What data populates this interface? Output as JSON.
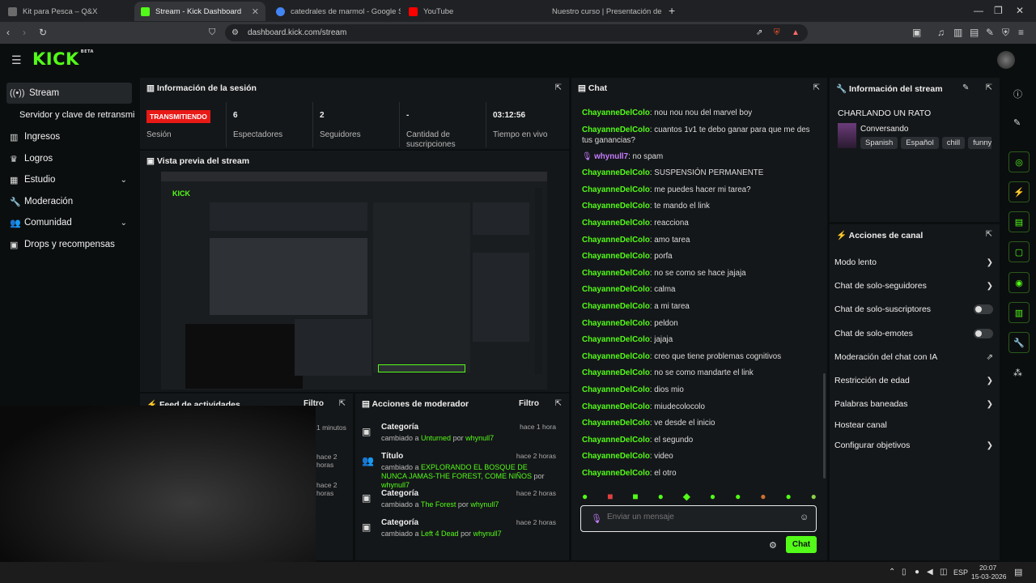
{
  "browser": {
    "tabs": [
      {
        "title": "Kit para Pesca – Q&X",
        "color": "#6b6b6b"
      },
      {
        "title": "Stream - Kick Dashboard",
        "color": "#53fc18"
      },
      {
        "title": "catedrales de marmol - Google Searc",
        "color": "#4285f4"
      },
      {
        "title": "YouTube",
        "color": "#ff0000"
      },
      {
        "title": "Nuestro curso | Presentación del curs",
        "color": "#444"
      }
    ],
    "new_tab": "+",
    "url": "dashboard.kick.com/stream"
  },
  "header": {
    "logo": "KICK",
    "logo_sup": "BETA"
  },
  "sidebar": {
    "items": [
      {
        "label": "Stream",
        "icon": "broadcast-icon"
      },
      {
        "label": "Servidor y clave de retransmi"
      },
      {
        "label": "Ingresos",
        "icon": "chart-icon"
      },
      {
        "label": "Logros",
        "icon": "trophy-icon"
      },
      {
        "label": "Estudio",
        "icon": "grid-icon"
      },
      {
        "label": "Moderación",
        "icon": "wrench-icon"
      },
      {
        "label": "Comunidad",
        "icon": "users-icon"
      },
      {
        "label": "Drops y recompensas",
        "icon": "gift-icon"
      }
    ]
  },
  "session": {
    "title": "Información de la sesión",
    "badge": "TRANSMITIENDO",
    "session_label": "Sesión",
    "stats": [
      {
        "value": "6",
        "label": "Espectadores"
      },
      {
        "value": "2",
        "label": "Seguidores"
      },
      {
        "value": "-",
        "label": "Cantidad de suscripciones"
      },
      {
        "value": "03:12:56",
        "label": "Tiempo en vivo"
      }
    ]
  },
  "preview": {
    "title": "Vista previa del stream"
  },
  "activity": {
    "title": "Feed de actividades",
    "filter": "Filtro",
    "times": [
      "1 minutos",
      "hace 2 horas",
      "hace 2 horas"
    ]
  },
  "mod_actions": {
    "title": "Acciones de moderador",
    "filter": "Filtro",
    "items": [
      {
        "type": "Categoría",
        "pre": "cambiado a ",
        "value": "Unturned",
        "by": " por ",
        "user": "whynull7",
        "time": "hace 1 hora"
      },
      {
        "type": "Título",
        "pre": "cambiado a ",
        "value": "EXPLORANDO EL BOSQUE DE NUNCA JAMAS-THE FOREST, COME NIÑOS",
        "by": " por ",
        "user": "whynull7",
        "time": "hace 2 horas"
      },
      {
        "type": "Categoría",
        "pre": "cambiado a ",
        "value": "The Forest",
        "by": " por ",
        "user": "whynull7",
        "time": "hace 2 horas"
      },
      {
        "type": "Categoría",
        "pre": "cambiado a ",
        "value": "Left 4 Dead",
        "by": " por ",
        "user": "whynull7",
        "time": "hace 2 horas"
      }
    ]
  },
  "chat": {
    "title": "Chat",
    "messages": [
      {
        "user": "ChayanneDelColo",
        "text": "nou nou nou del marvel boy"
      },
      {
        "user": "ChayanneDelColo",
        "text": "cuantos 1v1 te debo ganar para que me des tus ganancias?"
      },
      {
        "user": "whynull7",
        "text": "no spam",
        "mod": true
      },
      {
        "user": "ChayanneDelColo",
        "text": "SUSPENSIÓN PERMANENTE"
      },
      {
        "user": "ChayanneDelColo",
        "text": "me puedes hacer mi tarea?"
      },
      {
        "user": "ChayanneDelColo",
        "text": "te mando el link"
      },
      {
        "user": "ChayanneDelColo",
        "text": "reacciona"
      },
      {
        "user": "ChayanneDelColo",
        "text": "amo tarea"
      },
      {
        "user": "ChayanneDelColo",
        "text": "porfa"
      },
      {
        "user": "ChayanneDelColo",
        "text": "no se como se hace jajaja"
      },
      {
        "user": "ChayanneDelColo",
        "text": "calma"
      },
      {
        "user": "ChayanneDelColo",
        "text": "a mi tarea"
      },
      {
        "user": "ChayanneDelColo",
        "text": "peldon"
      },
      {
        "user": "ChayanneDelColo",
        "text": "jajaja"
      },
      {
        "user": "ChayanneDelColo",
        "text": "creo que tiene problemas cognitivos"
      },
      {
        "user": "ChayanneDelColo",
        "text": "no se como mandarte el link"
      },
      {
        "user": "ChayanneDelColo",
        "text": "dios mio"
      },
      {
        "user": "ChayanneDelColo",
        "text": "miudecolocolo"
      },
      {
        "user": "ChayanneDelColo",
        "text": "ve desde el inicio"
      },
      {
        "user": "ChayanneDelColo",
        "text": "el segundo"
      },
      {
        "user": "ChayanneDelColo",
        "text": "video"
      },
      {
        "user": "ChayanneDelColo",
        "text": "el otro"
      }
    ],
    "placeholder": "Enviar un mensaje",
    "send": "Chat"
  },
  "stream_info": {
    "title": "Información del stream",
    "stream_title": "CHARLANDO UN RATO",
    "category": "Conversando",
    "tags": [
      "Spanish",
      "Español",
      "chill",
      "funny"
    ]
  },
  "channel_actions": {
    "title": "Acciones de canal",
    "items": [
      {
        "label": "Modo lento",
        "kind": "arrow"
      },
      {
        "label": "Chat de solo-seguidores",
        "kind": "arrow"
      },
      {
        "label": "Chat de solo-suscriptores",
        "kind": "toggle"
      },
      {
        "label": "Chat de solo-emotes",
        "kind": "toggle"
      },
      {
        "label": "Moderación del chat con IA",
        "kind": "ext"
      },
      {
        "label": "Restricción de edad",
        "kind": "arrow"
      },
      {
        "label": "Palabras baneadas",
        "kind": "arrow"
      },
      {
        "label": "Hostear canal",
        "kind": "none"
      },
      {
        "label": "Configurar objetivos",
        "kind": "arrow"
      }
    ]
  },
  "taskbar": {
    "lang": "ESP",
    "time": "20:07",
    "date": "15-03-2026"
  },
  "colors": {
    "accent": "#53fc18",
    "live": "#e91916",
    "bg": "#0b0e0f",
    "panel": "#141719"
  }
}
